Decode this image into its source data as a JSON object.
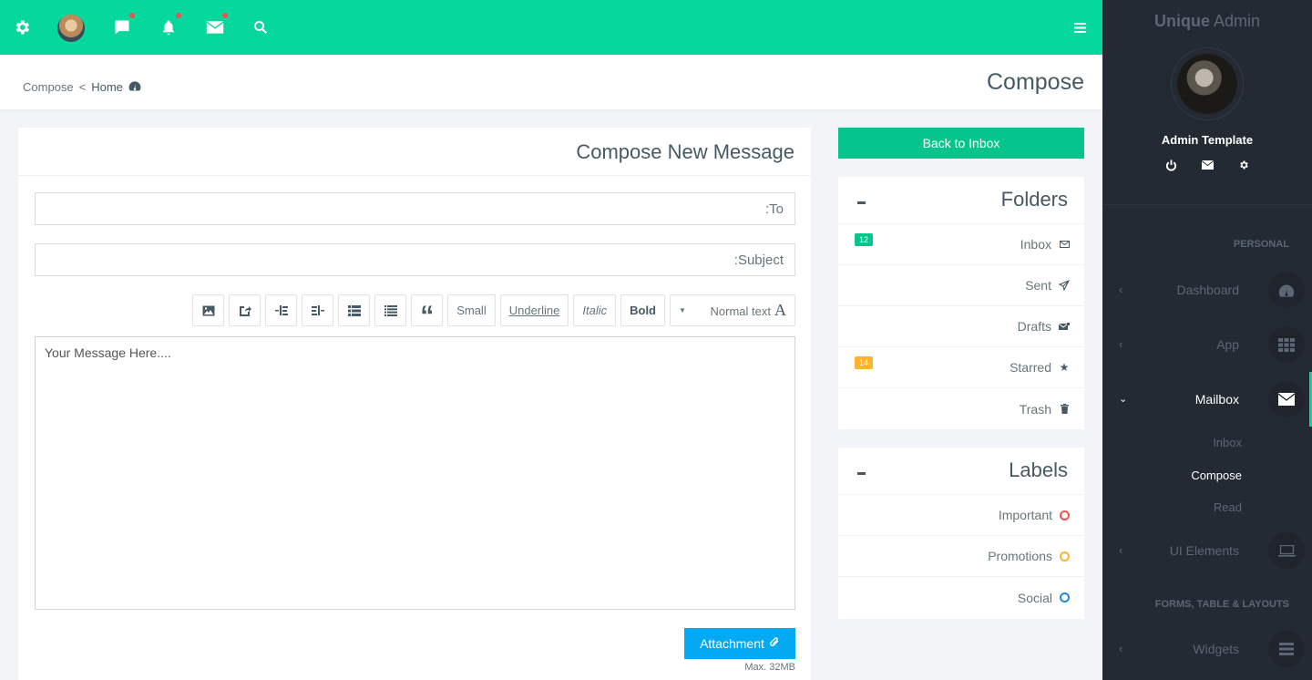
{
  "topbar": {
    "icons": [
      "gear-icon",
      "avatar",
      "chat-icon",
      "bell-icon",
      "envelope-icon",
      "search-icon",
      "hamburger-icon"
    ],
    "notification_color": "#ef5350",
    "bg_color": "#06d79c"
  },
  "breadcrumb": {
    "current": "Compose",
    "separator": "<",
    "home": "Home"
  },
  "page_title": "Compose",
  "compose": {
    "heading": "Compose New Message",
    "to_placeholder": ":To",
    "subject_placeholder": ":Subject",
    "message_placeholder": "Your Message Here....",
    "toolbar": {
      "small": "Small",
      "underline": "Underline",
      "italic": "Italic",
      "bold": "Bold",
      "text_style": "Normal text",
      "text_style_glyph": "A",
      "quote_glyph": "“"
    },
    "attachment_label": "Attachment",
    "max_size": "Max. 32MB"
  },
  "back_to_inbox": "Back to Inbox",
  "folders": {
    "title": "Folders",
    "items": [
      {
        "label": "Inbox",
        "icon": "envelope-outline-icon",
        "badge": "12",
        "badge_color": "#06c58c"
      },
      {
        "label": "Sent",
        "icon": "paper-plane-icon"
      },
      {
        "label": "Drafts",
        "icon": "draft-envelope-icon"
      },
      {
        "label": "Starred",
        "icon": "star-icon",
        "badge": "14",
        "badge_color": "#ffb22b"
      },
      {
        "label": "Trash",
        "icon": "trash-icon"
      }
    ]
  },
  "labels": {
    "title": "Labels",
    "items": [
      {
        "label": "Important",
        "color": "#ef5350"
      },
      {
        "label": "Promotions",
        "color": "#ffb22b"
      },
      {
        "label": "Social",
        "color": "#1e88e5"
      }
    ]
  },
  "sidebar": {
    "brand_bold": "Unique",
    "brand_light": " Admin",
    "profile_name": "Admin Template",
    "section_personal": "PERSONAL",
    "section_forms": "FORMS, TABLE & LAYOUTS",
    "nav": [
      {
        "label": "Dashboard",
        "icon": "dashboard-icon"
      },
      {
        "label": "App",
        "icon": "grid-icon"
      },
      {
        "label": "Mailbox",
        "icon": "envelope-icon",
        "active": true
      },
      {
        "label": "UI Elements",
        "icon": "laptop-icon"
      },
      {
        "label": "Widgets",
        "icon": "bars-icon"
      }
    ],
    "mailbox_sub": [
      "Inbox",
      "Compose",
      "Read"
    ],
    "active_sub": "Compose"
  }
}
